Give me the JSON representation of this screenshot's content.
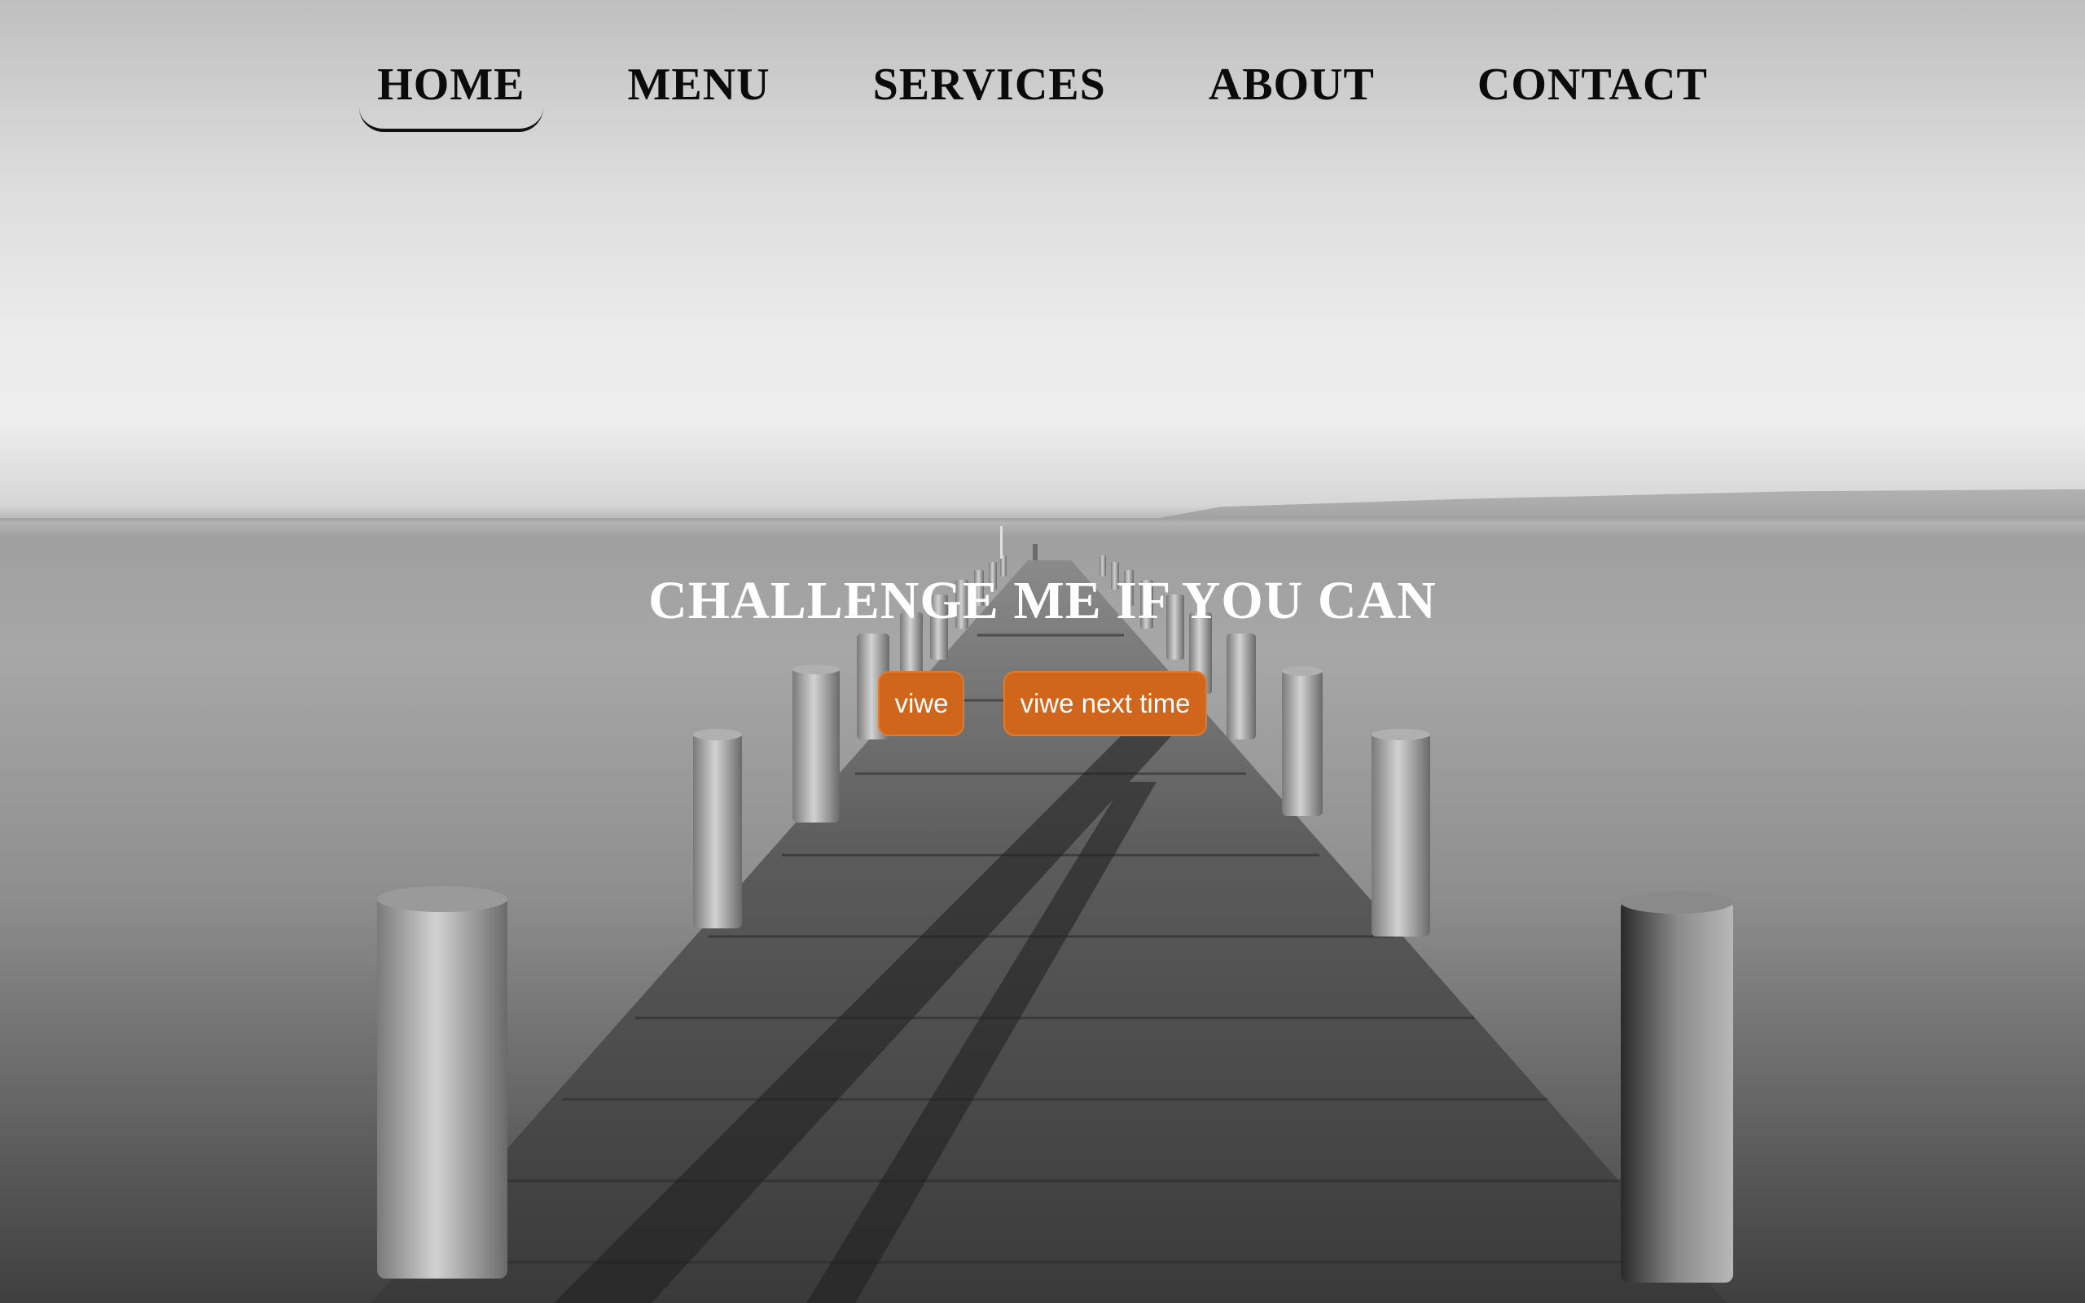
{
  "nav": {
    "items": [
      {
        "label": "HOME",
        "active": true
      },
      {
        "label": "MENU",
        "active": false
      },
      {
        "label": "SERVICES",
        "active": false
      },
      {
        "label": "ABOUT",
        "active": false
      },
      {
        "label": "CONTACT",
        "active": false
      }
    ]
  },
  "hero": {
    "title": "CHALLENGE ME IF YOU CAN",
    "primary_button": "viwe",
    "secondary_button": "viwe next time"
  },
  "colors": {
    "accent": "#d0661c",
    "hero_text": "#ffffff",
    "nav_text": "#0b0b0b"
  },
  "background": {
    "description_icon": "pier-image"
  }
}
